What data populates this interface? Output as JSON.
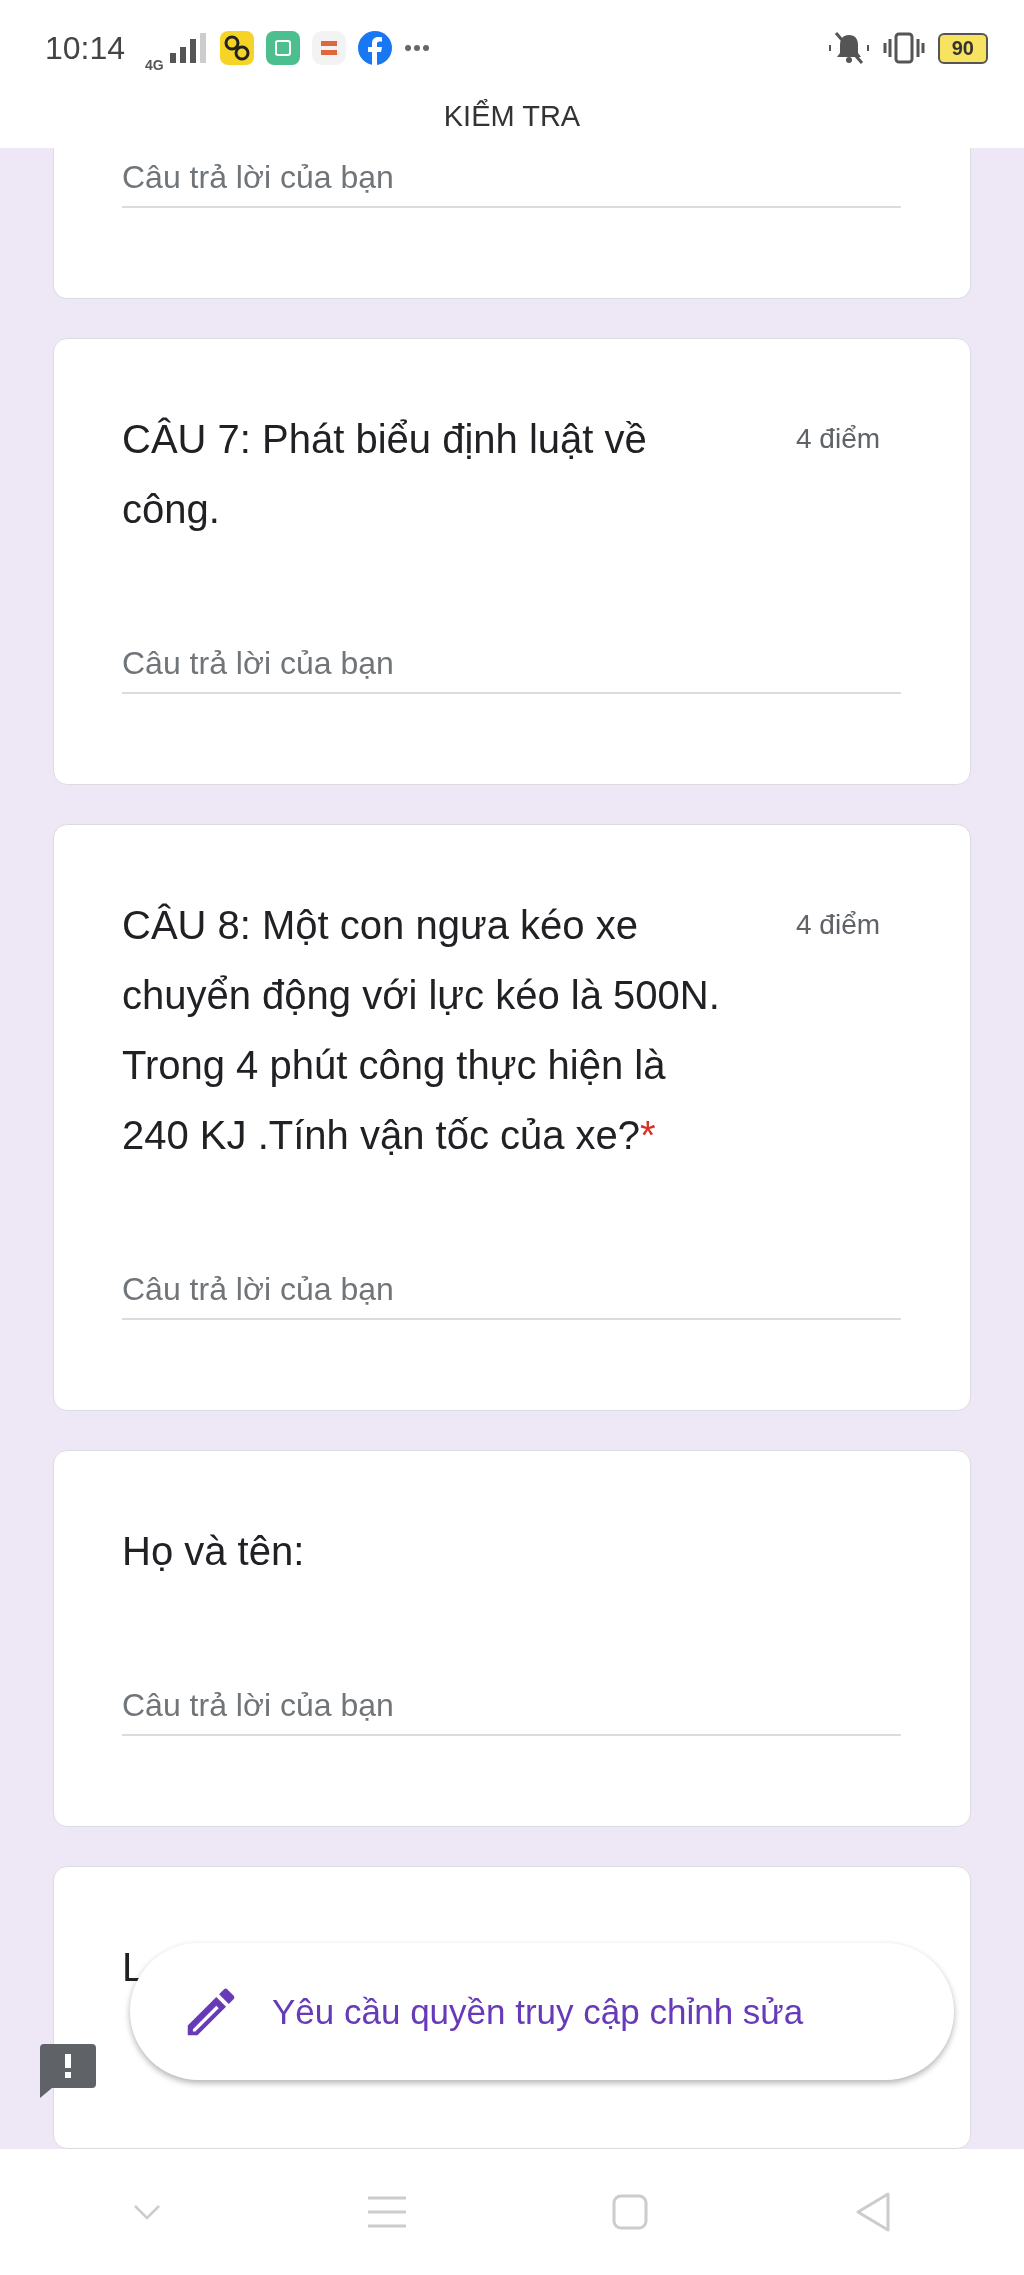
{
  "status_bar": {
    "time": "10:14",
    "network": "4G",
    "battery": "90"
  },
  "header": {
    "title": "KIỂM TRA"
  },
  "cards": [
    {
      "kind": "answer_only",
      "placeholder": "Câu trả lời của bạn"
    },
    {
      "kind": "question",
      "title": "CÂU 7: Phát biểu định luật về công.",
      "points": "4 điểm",
      "placeholder": "Câu trả lời của bạn"
    },
    {
      "kind": "question",
      "title": "CÂU 8: Một con ngưa kéo xe chuyển động với lực kéo là 500N. Trong 4 phút công thực hiện là 240 KJ .Tính vận tốc của xe?",
      "points": "4 điểm",
      "required_mark": "*",
      "placeholder": "Câu trả lời của bạn"
    },
    {
      "kind": "question",
      "title": "Họ và tên:",
      "placeholder": "Câu trả lời của bạn"
    },
    {
      "kind": "title_only",
      "title": "L"
    }
  ],
  "edit_access_button": {
    "label": "Yêu cầu quyền truy cập chỉnh sửa"
  }
}
